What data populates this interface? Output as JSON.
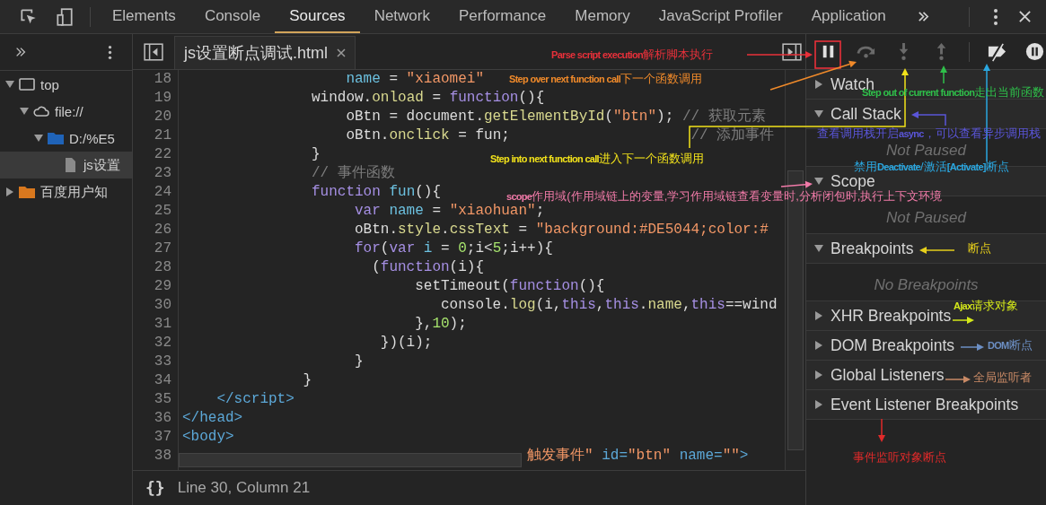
{
  "tabs": [
    {
      "label": "Elements",
      "selected": false
    },
    {
      "label": "Console",
      "selected": false
    },
    {
      "label": "Sources",
      "selected": true
    },
    {
      "label": "Network",
      "selected": false
    },
    {
      "label": "Performance",
      "selected": false
    },
    {
      "label": "Memory",
      "selected": false
    },
    {
      "label": "JavaScript Profiler",
      "selected": false
    },
    {
      "label": "Application",
      "selected": false
    }
  ],
  "tree": [
    {
      "label": "top",
      "kind": "frame",
      "expanded": true,
      "selected": false,
      "children": [
        {
          "label": "file://",
          "kind": "cloud",
          "expanded": true,
          "selected": false,
          "children": [
            {
              "label": "D:/%E5",
              "kind": "folder",
              "color": "#1f63b8",
              "expanded": true,
              "selected": false,
              "children": [
                {
                  "label": "js设置",
                  "kind": "file",
                  "selected": true
                }
              ]
            }
          ]
        }
      ]
    },
    {
      "label": "百度用户知",
      "kind": "folder",
      "color": "#d9781e",
      "expanded": false,
      "selected": false
    }
  ],
  "editor": {
    "file_tab": "js设置断点调试.html",
    "lines": [
      {
        "n": "18",
        "tokens": [
          {
            "kind": "variable",
            "t": "                   name"
          },
          {
            "kind": "plain",
            "t": " = "
          },
          {
            "kind": "string",
            "t": "\"xiaomei\""
          }
        ]
      },
      {
        "n": "19",
        "tokens": [
          {
            "kind": "plain",
            "t": "               window."
          },
          {
            "kind": "property",
            "t": "onload"
          },
          {
            "kind": "plain",
            "t": " = "
          },
          {
            "kind": "keyword",
            "t": "function"
          },
          {
            "kind": "plain",
            "t": "(){"
          }
        ]
      },
      {
        "n": "20",
        "tokens": [
          {
            "kind": "plain",
            "t": "                   oBtn = document."
          },
          {
            "kind": "property",
            "t": "getElementById"
          },
          {
            "kind": "plain",
            "t": "("
          },
          {
            "kind": "string",
            "t": "\"btn\""
          },
          {
            "kind": "plain",
            "t": "); "
          },
          {
            "kind": "comment",
            "t": "// 获取元素"
          }
        ]
      },
      {
        "n": "21",
        "tokens": [
          {
            "kind": "plain",
            "t": "                   oBtn."
          },
          {
            "kind": "property",
            "t": "onclick"
          },
          {
            "kind": "plain",
            "t": " = fun;"
          },
          {
            "kind": "comment",
            "t": "                     // 添加事件"
          }
        ]
      },
      {
        "n": "22",
        "tokens": [
          {
            "kind": "plain",
            "t": "               }"
          }
        ]
      },
      {
        "n": "23",
        "tokens": [
          {
            "kind": "comment",
            "t": "               // 事件函数"
          }
        ]
      },
      {
        "n": "24",
        "tokens": [
          {
            "kind": "keyword",
            "t": "               function "
          },
          {
            "kind": "variable",
            "t": "fun"
          },
          {
            "kind": "plain",
            "t": "(){"
          }
        ]
      },
      {
        "n": "25",
        "tokens": [
          {
            "kind": "keyword",
            "t": "                    var "
          },
          {
            "kind": "variable",
            "t": "name"
          },
          {
            "kind": "plain",
            "t": " = "
          },
          {
            "kind": "string",
            "t": "\"xiaohuan\""
          },
          {
            "kind": "plain",
            "t": ";"
          }
        ]
      },
      {
        "n": "26",
        "tokens": [
          {
            "kind": "plain",
            "t": "                    oBtn."
          },
          {
            "kind": "property",
            "t": "style"
          },
          {
            "kind": "plain",
            "t": "."
          },
          {
            "kind": "property",
            "t": "cssText"
          },
          {
            "kind": "plain",
            "t": " = "
          },
          {
            "kind": "string",
            "t": "\"background:#DE5044;color:#"
          }
        ]
      },
      {
        "n": "27",
        "tokens": [
          {
            "kind": "keyword",
            "t": "                    for"
          },
          {
            "kind": "plain",
            "t": "("
          },
          {
            "kind": "keyword",
            "t": "var "
          },
          {
            "kind": "variable",
            "t": "i"
          },
          {
            "kind": "plain",
            "t": " = "
          },
          {
            "kind": "number",
            "t": "0"
          },
          {
            "kind": "plain",
            "t": ";i<"
          },
          {
            "kind": "number",
            "t": "5"
          },
          {
            "kind": "plain",
            "t": ";i++){"
          }
        ]
      },
      {
        "n": "28",
        "tokens": [
          {
            "kind": "plain",
            "t": "                      ("
          },
          {
            "kind": "keyword",
            "t": "function"
          },
          {
            "kind": "plain",
            "t": "(i){"
          }
        ]
      },
      {
        "n": "29",
        "tokens": [
          {
            "kind": "plain",
            "t": "                           setTimeout("
          },
          {
            "kind": "keyword",
            "t": "function"
          },
          {
            "kind": "plain",
            "t": "(){"
          }
        ]
      },
      {
        "n": "30",
        "tokens": [
          {
            "kind": "plain",
            "t": "                              console."
          },
          {
            "kind": "property",
            "t": "log"
          },
          {
            "kind": "plain",
            "t": "(i,"
          },
          {
            "kind": "keyword",
            "t": "this"
          },
          {
            "kind": "plain",
            "t": ","
          },
          {
            "kind": "keyword",
            "t": "this"
          },
          {
            "kind": "plain",
            "t": "."
          },
          {
            "kind": "property",
            "t": "name"
          },
          {
            "kind": "plain",
            "t": ","
          },
          {
            "kind": "keyword",
            "t": "this"
          },
          {
            "kind": "plain",
            "t": "==wind"
          }
        ]
      },
      {
        "n": "31",
        "tokens": [
          {
            "kind": "plain",
            "t": "                           },"
          },
          {
            "kind": "number",
            "t": "10"
          },
          {
            "kind": "plain",
            "t": ");"
          }
        ]
      },
      {
        "n": "32",
        "tokens": [
          {
            "kind": "plain",
            "t": "                       })(i);"
          }
        ]
      },
      {
        "n": "33",
        "tokens": [
          {
            "kind": "plain",
            "t": "                    }"
          }
        ]
      },
      {
        "n": "34",
        "tokens": [
          {
            "kind": "plain",
            "t": "              }"
          }
        ]
      },
      {
        "n": "35",
        "tokens": [
          {
            "kind": "tag",
            "t": "    </script>"
          }
        ]
      },
      {
        "n": "36",
        "tokens": [
          {
            "kind": "tag",
            "t": "</head>"
          }
        ]
      },
      {
        "n": "37",
        "tokens": [
          {
            "kind": "tag",
            "t": "<body>"
          }
        ]
      },
      {
        "n": "38",
        "tokens": [
          {
            "kind": "string",
            "t": "                                        触发事件\""
          },
          {
            "kind": "tag",
            "t": " id="
          },
          {
            "kind": "string",
            "t": "\"btn\""
          },
          {
            "kind": "tag",
            "t": " name="
          },
          {
            "kind": "string",
            "t": "\"\""
          },
          {
            "kind": "tag",
            "t": ">"
          }
        ]
      }
    ],
    "format_button": "{}",
    "cursor": "Line 30, Column 21"
  },
  "debug_buttons": [
    {
      "kind": "pause",
      "disabled": false
    },
    {
      "kind": "step-over",
      "disabled": true
    },
    {
      "kind": "step-into",
      "disabled": true
    },
    {
      "kind": "step-out",
      "disabled": true
    },
    {
      "kind": "deactivate",
      "disabled": false
    },
    {
      "kind": "pause-exceptions",
      "disabled": false
    }
  ],
  "sections": [
    {
      "title": "Watch",
      "expanded": false
    },
    {
      "title": "Call Stack",
      "expanded": true,
      "message": "Not Paused"
    },
    {
      "title": "Scope",
      "expanded": true,
      "message": "Not Paused"
    },
    {
      "title": "Breakpoints",
      "expanded": true,
      "message": "No Breakpoints"
    },
    {
      "title": "XHR Breakpoints",
      "expanded": false
    },
    {
      "title": "DOM Breakpoints",
      "expanded": false
    },
    {
      "title": "Global Listeners",
      "expanded": false
    },
    {
      "title": "Event Listener Breakpoints",
      "expanded": false
    }
  ],
  "annotations": [
    {
      "text": "**Parse script execution**解析脚本执行",
      "color": "#e8303a"
    },
    {
      "text": "**Step over next function call**下一个函数调用",
      "color": "#f08a2a"
    },
    {
      "text": "**Step into next function call**进入下一个函数调用",
      "color": "#f2e21a"
    },
    {
      "text": "**Step out of current function**走出当前函数",
      "color": "#2fbf4a"
    },
    {
      "text": "查看调用栈开启**async**，可以查看异步调用栈",
      "color": "#5a55d8"
    },
    {
      "text": "禁用**Deactivate**/激活**[Activate]**断点",
      "color": "#2aa7e0"
    },
    {
      "text": "**scope**作用域(作用域链上的变量,学习作用域链查看变量时,分析闭包时,执行上下文环境",
      "color": "#f07aa8"
    },
    {
      "text": "断点",
      "color": "#e6cf1b"
    },
    {
      "text": "**Ajax**请求对象",
      "color": "#d4e81a"
    },
    {
      "text": "**DOM**断点",
      "color": "#6c8fc4"
    },
    {
      "text": "全局监听者",
      "color": "#c98a66"
    },
    {
      "text": "事件监听对象断点",
      "color": "#e02a2a"
    }
  ]
}
